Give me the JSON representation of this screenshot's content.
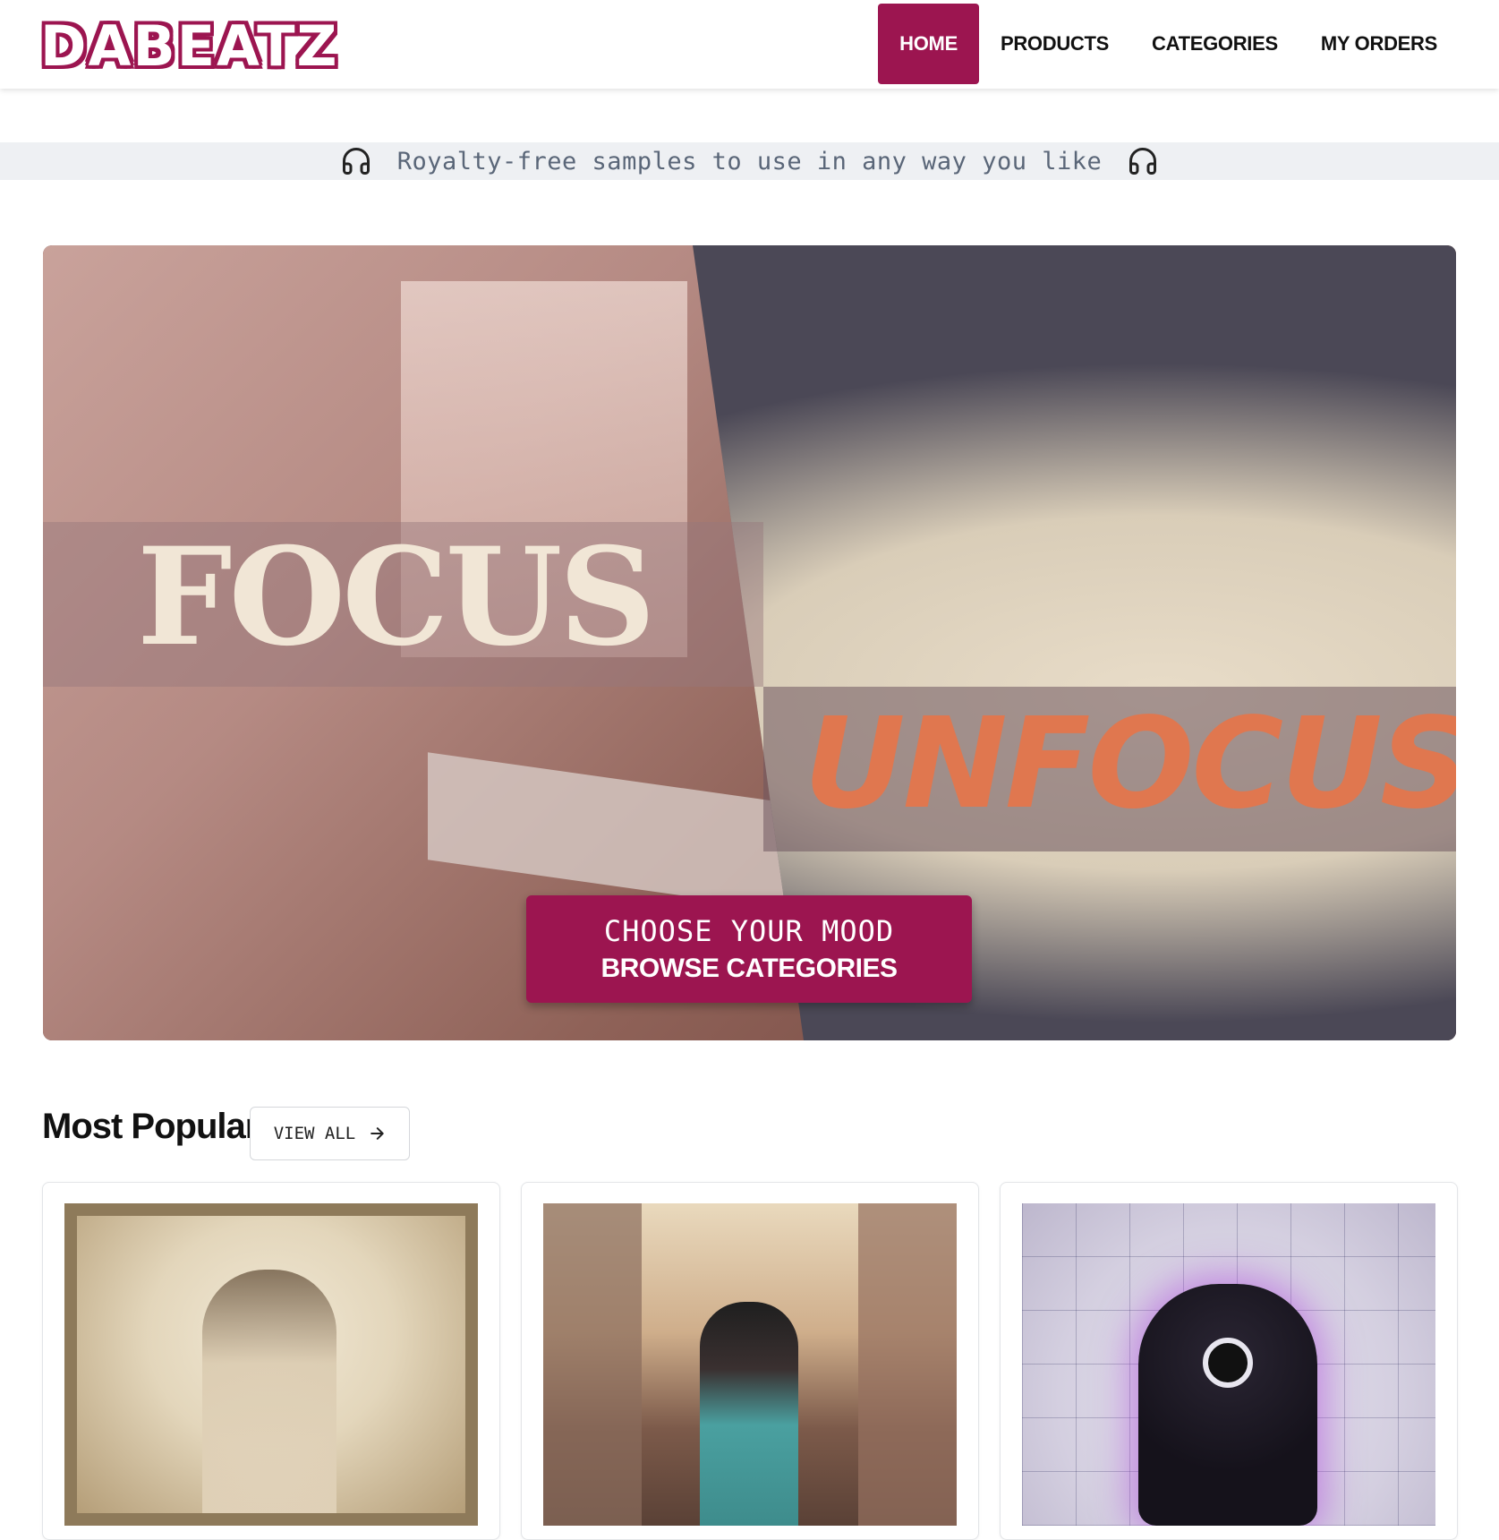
{
  "header": {
    "logo": "DABEATZ",
    "nav": [
      {
        "label": "HOME",
        "active": true
      },
      {
        "label": "PRODUCTS",
        "active": false
      },
      {
        "label": "CATEGORIES",
        "active": false
      },
      {
        "label": "MY ORDERS",
        "active": false
      }
    ]
  },
  "strip": {
    "text": "Royalty-free samples to use in any way you like",
    "icon": "headphones-icon"
  },
  "hero": {
    "word_left": "FOCUS",
    "word_right": "UNFOCUS",
    "cta_line1": "CHOOSE YOUR MOOD",
    "cta_line2": "BROWSE CATEGORIES"
  },
  "popular": {
    "title": "Most Popular",
    "view_all": "VIEW ALL",
    "cards": [
      {
        "image": "vintage-violinist-illustration"
      },
      {
        "image": "hiphop-street-illustration"
      },
      {
        "image": "techno-speaker-robot-illustration"
      }
    ]
  },
  "colors": {
    "brand": "#9c1550",
    "strip_bg": "#eef0f3",
    "strip_text": "#5a6678",
    "unfocus": "#e0774f",
    "focus": "#f1e6d6"
  }
}
